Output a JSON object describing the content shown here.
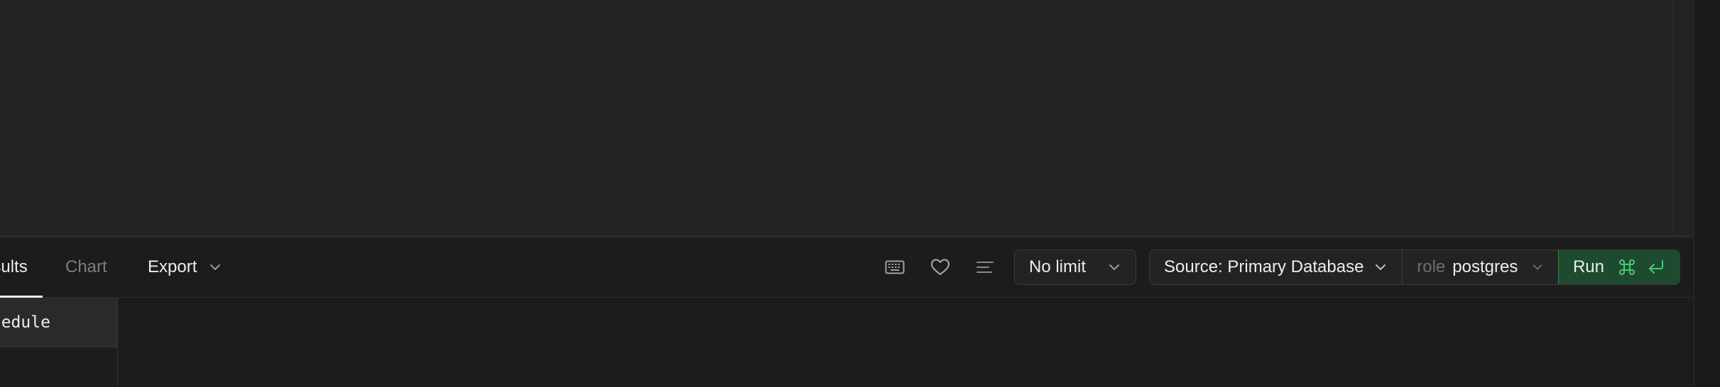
{
  "results_tabs": [
    {
      "label": "Results",
      "visible_label": "esults",
      "active": true
    },
    {
      "label": "Chart",
      "active": false
    }
  ],
  "export": {
    "label": "Export"
  },
  "toolbar_icons": [
    "keyboard-icon",
    "heart-icon",
    "align-left-icon"
  ],
  "limit": {
    "value": "No limit"
  },
  "source": {
    "label": "Source: Primary Database"
  },
  "role": {
    "prefix": "role",
    "value": "postgres"
  },
  "run": {
    "label": "Run"
  },
  "results_table": {
    "columns": [
      {
        "label": "schedule",
        "visible_label": "chedule"
      }
    ]
  },
  "colors": {
    "accent_green": "#1e4a30",
    "background": "#1c1c1c",
    "editor": "#232323"
  }
}
